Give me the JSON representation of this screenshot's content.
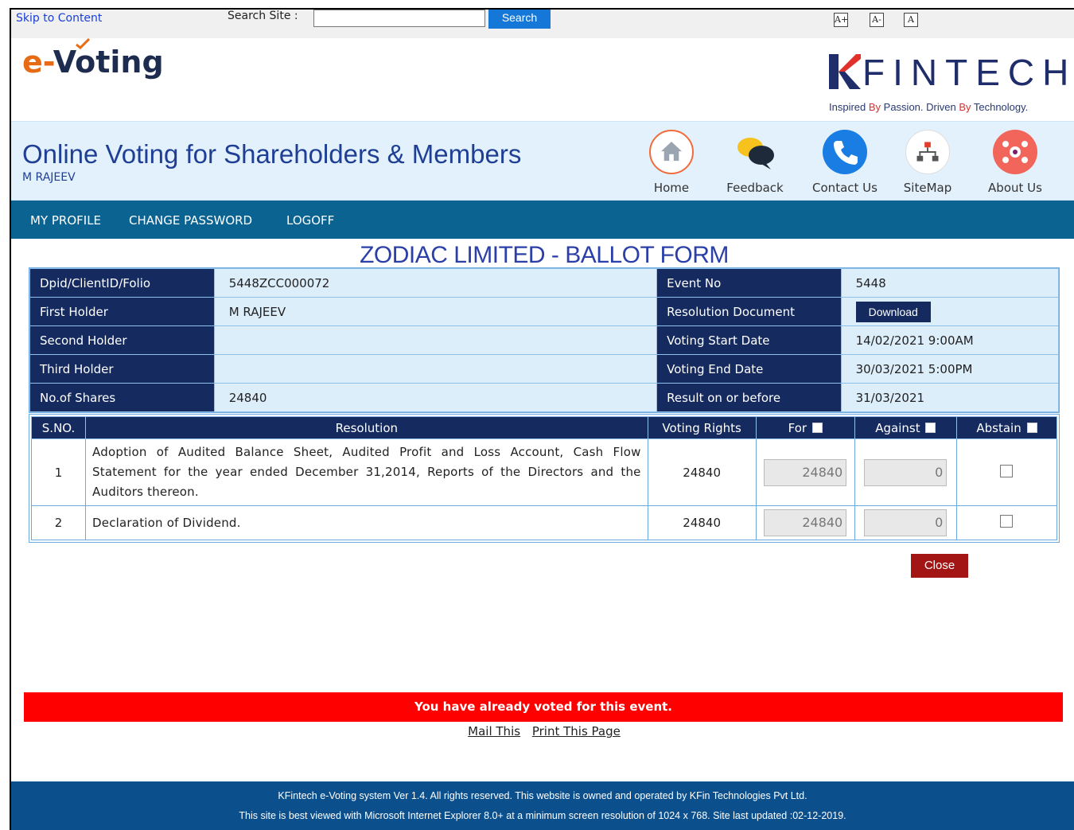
{
  "topbar": {
    "skip_label": "Skip to Content",
    "search_label": "Search Site :",
    "search_value": "",
    "search_button": "Search",
    "font_buttons": [
      "A+",
      "A-",
      "A"
    ]
  },
  "brand": {
    "evoting_e": "e-",
    "evoting_rest": "Voting",
    "kfintech_logo_text": "FINTECH",
    "tagline_1": "Inspired ",
    "tagline_by1": "By",
    "tagline_2": " Passion. Driven ",
    "tagline_by2": "By",
    "tagline_3": " Technology."
  },
  "header": {
    "title": "Online Voting for Shareholders & Members",
    "user": "M RAJEEV",
    "nav": [
      {
        "label": "Home",
        "icon": "home-icon",
        "color": "#f26b3a"
      },
      {
        "label": "Feedback",
        "icon": "feedback-icon",
        "color": "#f7c21e"
      },
      {
        "label": "Contact Us",
        "icon": "phone-icon",
        "color": "#1a7de3"
      },
      {
        "label": "SiteMap",
        "icon": "sitemap-icon",
        "color": "#e43b2d"
      },
      {
        "label": "About Us",
        "icon": "about-icon",
        "color": "#f2655a"
      }
    ]
  },
  "menu": {
    "profile": "MY PROFILE",
    "change_password": "CHANGE PASSWORD",
    "logoff": "LOGOFF"
  },
  "ballot": {
    "title": "ZODIAC LIMITED - BALLOT FORM",
    "info": {
      "dpid_label": "Dpid/ClientID/Folio",
      "dpid_value": "5448ZCC000072",
      "event_label": "Event No",
      "event_value": "5448",
      "first_label": "First Holder",
      "first_value": "M RAJEEV",
      "resdoc_label": "Resolution Document",
      "download_button": "Download",
      "second_label": "Second Holder",
      "second_value": "",
      "vstart_label": "Voting Start Date",
      "vstart_value": "14/02/2021 9:00AM",
      "third_label": "Third Holder",
      "third_value": "",
      "vend_label": "Voting End Date",
      "vend_value": "30/03/2021 5:00PM",
      "shares_label": "No.of Shares",
      "shares_value": "24840",
      "result_label": "Result on or before",
      "result_value": "31/03/2021"
    },
    "columns": {
      "sno": "S.NO.",
      "resolution": "Resolution",
      "rights": "Voting Rights",
      "for": "For",
      "against": "Against",
      "abstain": "Abstain"
    },
    "rows": [
      {
        "sno": "1",
        "text": "Adoption of Audited Balance Sheet, Audited Profit and Loss Account, Cash Flow Statement for the year ended December 31,2014, Reports of the Directors and the Auditors thereon.",
        "rights": "24840",
        "for": "24840",
        "against": "0"
      },
      {
        "sno": "2",
        "text": "Declaration of Dividend.",
        "rights": "24840",
        "for": "24840",
        "against": "0"
      }
    ],
    "close_button": "Close",
    "voted_message": "You have already voted for this event.",
    "mail_link": "Mail This",
    "print_link": "Print This Page"
  },
  "footer": {
    "line1": "KFintech e-Voting system Ver 1.4. All rights reserved. This website is owned and operated by KFin Technologies Pvt Ltd.",
    "line2": "This site is best viewed with Microsoft Internet Explorer 8.0+ at a minimum screen resolution of 1024 x 768. Site last updated :02-12-2019."
  }
}
